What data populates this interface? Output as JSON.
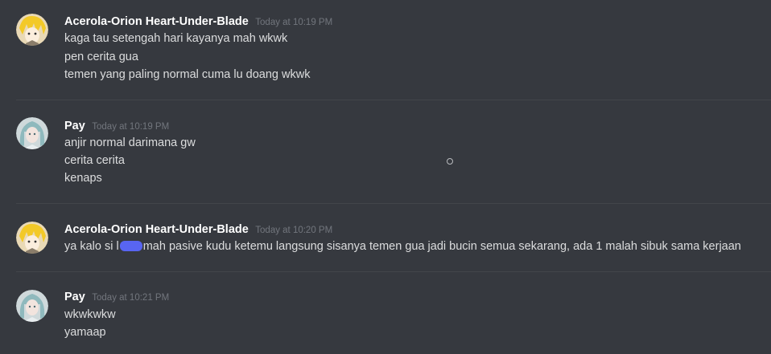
{
  "messages": [
    {
      "username": "Acerola-Orion Heart-Under-Blade",
      "timestamp": "Today at 10:19 PM",
      "lines": [
        "kaga tau setengah hari kayanya mah wkwk",
        "pen cerita gua",
        "temen yang paling normal cuma lu doang wkwk"
      ]
    },
    {
      "username": "Pay",
      "timestamp": "Today at 10:19 PM",
      "lines": [
        "anjir normal darimana gw",
        "cerita cerita",
        "kenaps"
      ]
    },
    {
      "username": "Acerola-Orion Heart-Under-Blade",
      "timestamp": "Today at 10:20 PM",
      "lines_parts": {
        "before": "ya kalo si l",
        "after": "mah pasive kudu ketemu langsung sisanya temen gua jadi bucin semua sekarang, ada 1 malah sibuk sama kerjaan"
      }
    },
    {
      "username": "Pay",
      "timestamp": "Today at 10:21 PM",
      "lines": [
        "wkwkwkw",
        "yamaap"
      ]
    }
  ],
  "colors": {
    "background": "#36393f",
    "username": "#ffffff",
    "timestamp": "#72767d",
    "text": "#dcddde",
    "redaction": "#5865f2"
  },
  "avatars": {
    "acerola": "anime-blonde-avatar",
    "pay": "anime-silver-hair-avatar"
  }
}
